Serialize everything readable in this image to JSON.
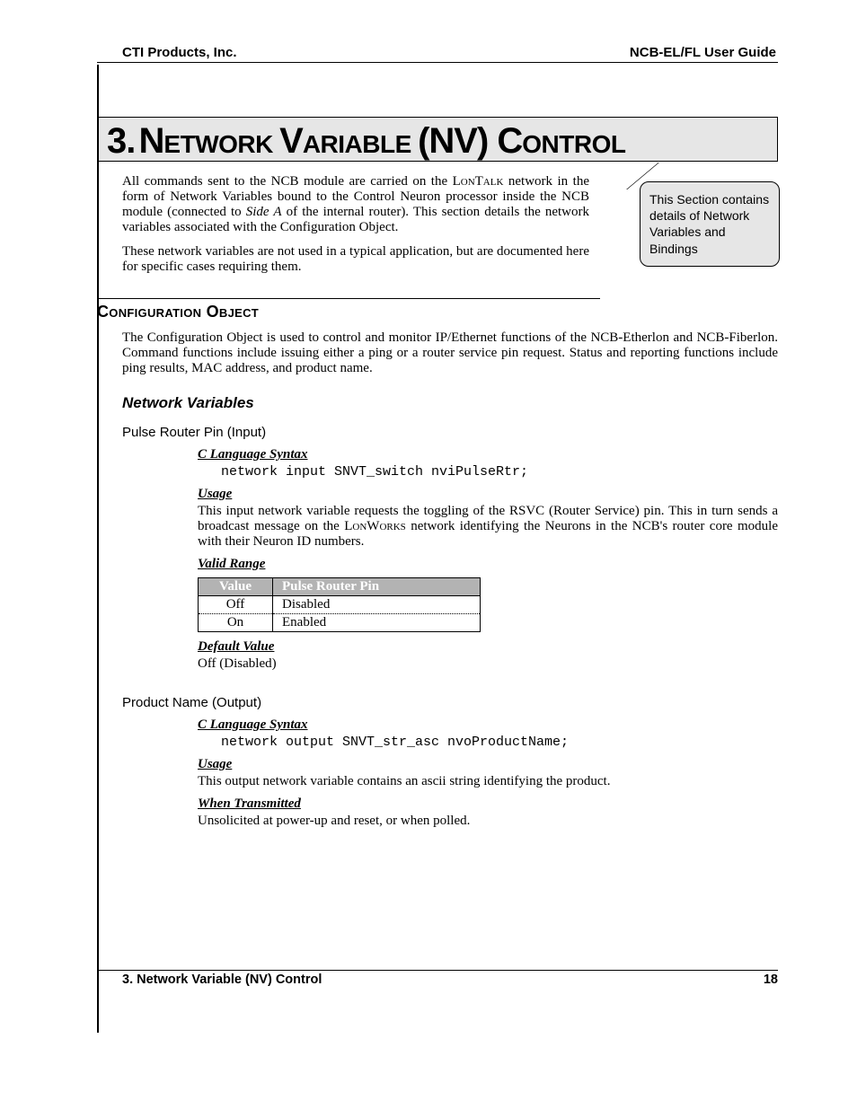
{
  "header": {
    "left": "CTI Products, Inc.",
    "right": "NCB-EL/FL User Guide"
  },
  "chapter": {
    "number": "3.",
    "title_parts": [
      "N",
      "ETWORK ",
      "V",
      "ARIABLE ",
      "(NV) C",
      "ONTROL"
    ]
  },
  "intro": {
    "p1a": "All commands sent to the NCB module are carried on the ",
    "p1_lontalk": "LonTalk",
    "p1b": " network in the form of Network Variables bound to the Control Neuron processor inside the NCB module (connected to ",
    "p1_sidea": "Side A",
    "p1c": " of the internal router).  This section details the network variables associated with the Configuration Object.",
    "p2": "These network variables are not used in a typical application, but are documented here for specific cases requiring them."
  },
  "callout": "This Section contains details of Network Variables and Bindings",
  "config_object": {
    "heading": "Configuration Object",
    "body": "The Configuration Object  is used to control and monitor IP/Ethernet functions of the NCB-Etherlon and NCB-Fiberlon.  Command functions include issuing either a ping or a router service pin request.  Status and reporting functions include ping results, MAC address, and product name."
  },
  "network_variables_heading": "Network Variables",
  "nv1": {
    "heading": "Pulse Router Pin (Input)",
    "syntax_label": "C Language Syntax",
    "syntax_code": "network input SNVT_switch nviPulseRtr;",
    "usage_label": "Usage",
    "usage_body_a": "This input network variable requests the toggling of the RSVC (Router Service) pin.  This in turn sends a broadcast message on the ",
    "usage_lonworks": "LonWorks",
    "usage_body_b": " network identifying the Neurons in the NCB's router core module with their Neuron ID numbers.",
    "valid_range_label": "Valid Range",
    "table": {
      "headers": [
        "Value",
        "Pulse Router Pin"
      ],
      "rows": [
        [
          "Off",
          "Disabled"
        ],
        [
          "On",
          "Enabled"
        ]
      ]
    },
    "default_label": "Default Value",
    "default_body": "Off (Disabled)"
  },
  "nv2": {
    "heading": "Product Name (Output)",
    "syntax_label": "C Language Syntax",
    "syntax_code": "network output SNVT_str_asc nvoProductName;",
    "usage_label": "Usage",
    "usage_body": "This output network variable contains an ascii string identifying the product.",
    "when_label": "When Transmitted",
    "when_body": "Unsolicited at power-up and reset, or when polled."
  },
  "footer": {
    "left": "3. Network Variable (NV) Control",
    "right": "18"
  }
}
